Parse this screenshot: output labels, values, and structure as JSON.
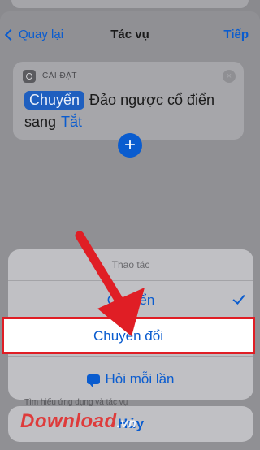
{
  "nav": {
    "back_label": "Quay lại",
    "title": "Tác vụ",
    "next_label": "Tiếp"
  },
  "card": {
    "category": "CÀI ĐẶT",
    "verb_chip": "Chuyển",
    "text": "Đảo ngược cổ điển",
    "line2_prefix": "sang",
    "value": "Tắt",
    "close_symbol": "×"
  },
  "add_symbol": "+",
  "action_sheet": {
    "title": "Thao tác",
    "option1": "Chuyển",
    "option2": "Chuyển đổi",
    "option3": "Hỏi mỗi lần",
    "cancel": "Hủy",
    "obscured_text": "Tìm hiểu ứng dụng và tác vụ"
  },
  "logo": {
    "text": "Download",
    "suffix": ".vn"
  },
  "colors": {
    "accent": "#0a5ccf",
    "highlight": "#e01e25"
  }
}
